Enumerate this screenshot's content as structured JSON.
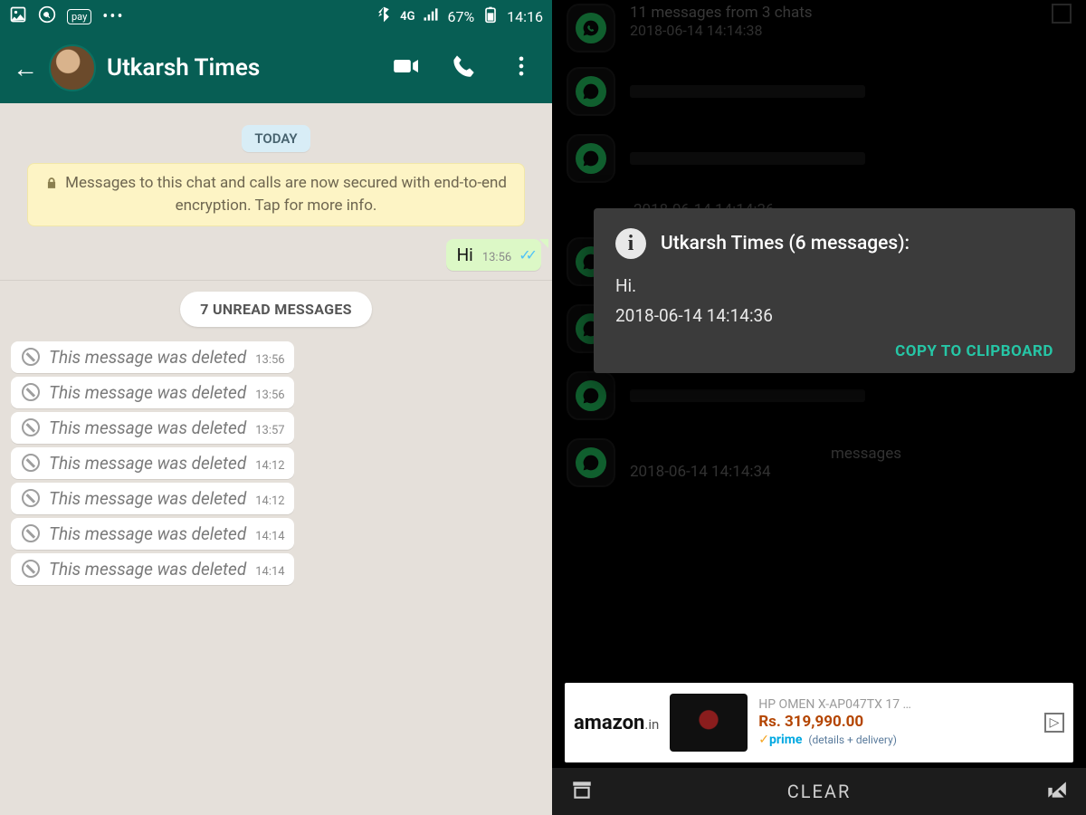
{
  "left": {
    "statusbar": {
      "network": "4G",
      "battery": "67%",
      "clock": "14:16"
    },
    "contact_name": "Utkarsh Times",
    "date_pill": "TODAY",
    "encryption_notice": "Messages to this chat and calls are now secured with end-to-end encryption. Tap for more info.",
    "outgoing": {
      "text": "Hi",
      "time": "13:56"
    },
    "unread_pill": "7 UNREAD MESSAGES",
    "deleted_label": "This message was deleted",
    "deleted": [
      {
        "time": "13:56"
      },
      {
        "time": "13:56"
      },
      {
        "time": "13:57"
      },
      {
        "time": "14:12"
      },
      {
        "time": "14:12"
      },
      {
        "time": "14:14"
      },
      {
        "time": "14:14"
      }
    ]
  },
  "right": {
    "header": {
      "title": "11 messages from 3 chats",
      "sub": "2018-06-14 14:14:38"
    },
    "visible_timestamp": "2018-06-14 14:14:36",
    "footer_row": {
      "label": "messages",
      "sub": "2018-06-14 14:14:34"
    },
    "modal": {
      "title": "Utkarsh Times (6 messages):",
      "line1": "Hi.",
      "line2": "2018-06-14 14:14:36",
      "action": "COPY TO CLIPBOARD"
    },
    "ad": {
      "brand": "amazon",
      "tld": ".in",
      "product": "HP OMEN X-AP047TX 17 …",
      "price": "Rs. 319,990.00",
      "prime": "prime",
      "details": "(details + delivery)"
    },
    "bottombar": {
      "clear": "CLEAR"
    }
  }
}
